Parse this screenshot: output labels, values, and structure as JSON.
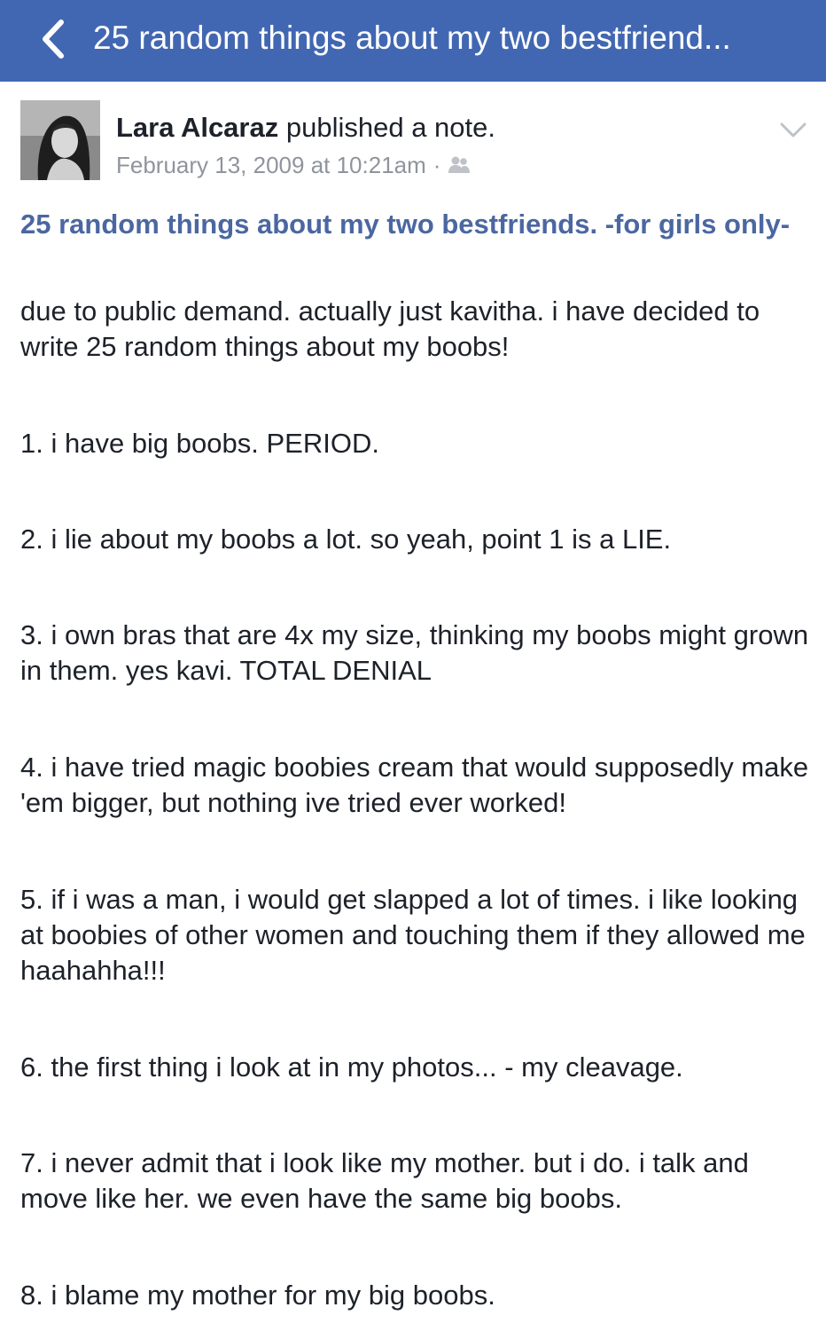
{
  "nav": {
    "title": "25 random things about my two bestfriend...",
    "back_icon": "chevron-left-icon"
  },
  "post": {
    "author": "Lara Alcaraz",
    "action": "published a note.",
    "date": "February 13, 2009 at 10:21am",
    "separator": "·",
    "privacy_icon": "friends-icon",
    "menu_icon": "chevron-down-icon"
  },
  "note": {
    "title": "25 random things about my two bestfriends. -for girls only-",
    "intro": "due to public demand. actually just kavitha. i have decided to write 25 random things about my boobs!",
    "items": [
      "1. i have big boobs. PERIOD.",
      "2. i lie about my boobs a lot. so yeah, point 1 is a LIE.",
      "3. i own bras that are 4x my size, thinking my boobs might grown in them. yes kavi. TOTAL DENIAL",
      "4. i have tried magic boobies cream that would supposedly make 'em bigger, but nothing ive tried ever worked!",
      "5. if i was a man, i would get slapped a lot of times. i like looking at boobies of other women and touching them if they allowed me haahahha!!!",
      "6. the first thing i look at in my photos... - my cleavage.",
      "7. i never admit that i look like my mother. but i do. i talk and move like her. we even have the same big boobs.",
      "8. i blame my mother for my big boobs."
    ]
  },
  "colors": {
    "navbar": "#4267b2",
    "link": "#4b67a1",
    "meta": "#90949c",
    "text": "#1d2129"
  }
}
